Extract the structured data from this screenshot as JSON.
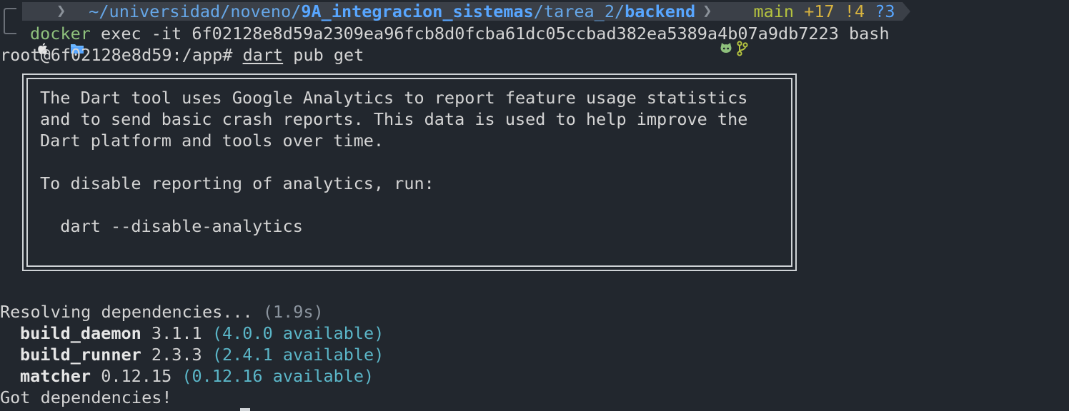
{
  "prompt": {
    "path_prefix": "~/universidad/noveno/",
    "path_bold_1": "9A_integracion_sistemas",
    "path_mid": "/tarea_2/",
    "path_bold_2": "backend",
    "git_branch": "main",
    "git_added": "+17",
    "git_modified": "!4",
    "git_untracked": "?3"
  },
  "command_line": {
    "cmd": "docker",
    "args": " exec -it 6f02128e8d59a2309ea96fcb8d0fcba61dc05ccbad382ea5389a4b07a9db7223 bash"
  },
  "shell_line": {
    "prompt": "root@6f02128e8d59:/app# ",
    "cmd": "dart",
    "args": " pub get"
  },
  "analytics_box": {
    "line1": "The Dart tool uses Google Analytics to report feature usage statistics",
    "line2": "and to send basic crash reports. This data is used to help improve the",
    "line3": "Dart platform and tools over time.",
    "line4": "To disable reporting of analytics, run:",
    "line5": "  dart --disable-analytics"
  },
  "output": {
    "resolving": "Resolving dependencies... ",
    "resolving_time": "(1.9s)",
    "deps": [
      {
        "name": "build_daemon",
        "version": " 3.1.1 ",
        "available": "(4.0.0 available)"
      },
      {
        "name": "build_runner",
        "version": " 2.3.3 ",
        "available": "(2.4.1 available)"
      },
      {
        "name": "matcher",
        "version": " 0.12.15 ",
        "available": "(0.12.16 available)"
      }
    ],
    "done": "Got dependencies!"
  },
  "colors": {
    "background": "#22272e",
    "path_blue": "#58a6ff",
    "git_green": "#b5c33f",
    "available_teal": "#5bb6c8",
    "command_green": "#8ec07c"
  },
  "icons": [
    "apple-icon",
    "folder-icon",
    "github-icon",
    "git-branch-icon"
  ]
}
